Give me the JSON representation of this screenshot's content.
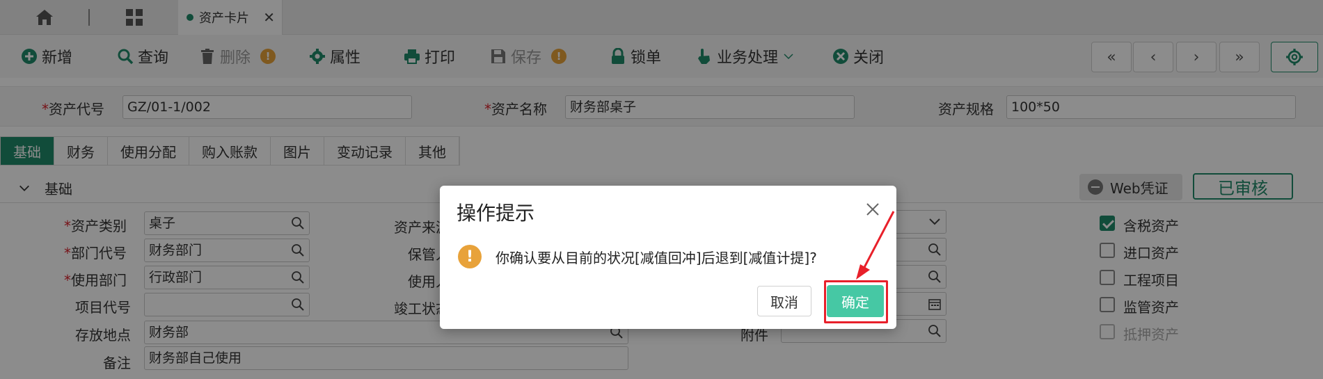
{
  "topbar": {
    "tab_label": "资产卡片",
    "tab_close": "✕"
  },
  "toolbar": {
    "add": "新增",
    "query": "查询",
    "delete": "删除",
    "attributes": "属性",
    "print": "打印",
    "save": "保存",
    "lock": "锁单",
    "business": "业务处理",
    "close": "关闭",
    "warn_mark": "!",
    "nav_first": "«",
    "nav_prev": "‹",
    "nav_next": "›",
    "nav_last": "»"
  },
  "header": {
    "code_label": "资产代号",
    "code_value": "GZ/01-1/002",
    "name_label": "资产名称",
    "name_value": "财务部桌子",
    "spec_label": "资产规格",
    "spec_value": "100*50",
    "required_mark": "*"
  },
  "subtabs": [
    "基础",
    "财务",
    "使用分配",
    "购入账款",
    "图片",
    "变动记录",
    "其他"
  ],
  "section": {
    "title": "基础",
    "web_voucher": "Web凭证",
    "audited": "已审核"
  },
  "form": {
    "category_label": "资产类别",
    "category_value": "桌子",
    "dept_label": "部门代号",
    "dept_value": "财务部门",
    "use_dept_label": "使用部门",
    "use_dept_value": "行政部门",
    "project_label": "项目代号",
    "project_value": "",
    "location_label": "存放地点",
    "location_value": "财务部",
    "remark_label": "备注",
    "remark_value": "财务部自己使用",
    "source_label": "资产来源",
    "keeper_label": "保管人",
    "user_label": "使用人",
    "completion_label": "竣工状态",
    "attachment_label": "附件"
  },
  "checkboxes": [
    {
      "label": "含税资产",
      "checked": true
    },
    {
      "label": "进口资产",
      "checked": false
    },
    {
      "label": "工程项目",
      "checked": false
    },
    {
      "label": "监管资产",
      "checked": false
    },
    {
      "label": "抵押资产",
      "checked": false
    }
  ],
  "dialog": {
    "title": "操作提示",
    "message": "你确认要从目前的状况[减值回冲]后退到[减值计提]?",
    "warn_mark": "!",
    "cancel": "取消",
    "ok": "确定"
  },
  "colors": {
    "accent": "#1f8a6a",
    "ok_button": "#46c8a4",
    "warning": "#e8a23a",
    "highlight": "#e8202a"
  }
}
